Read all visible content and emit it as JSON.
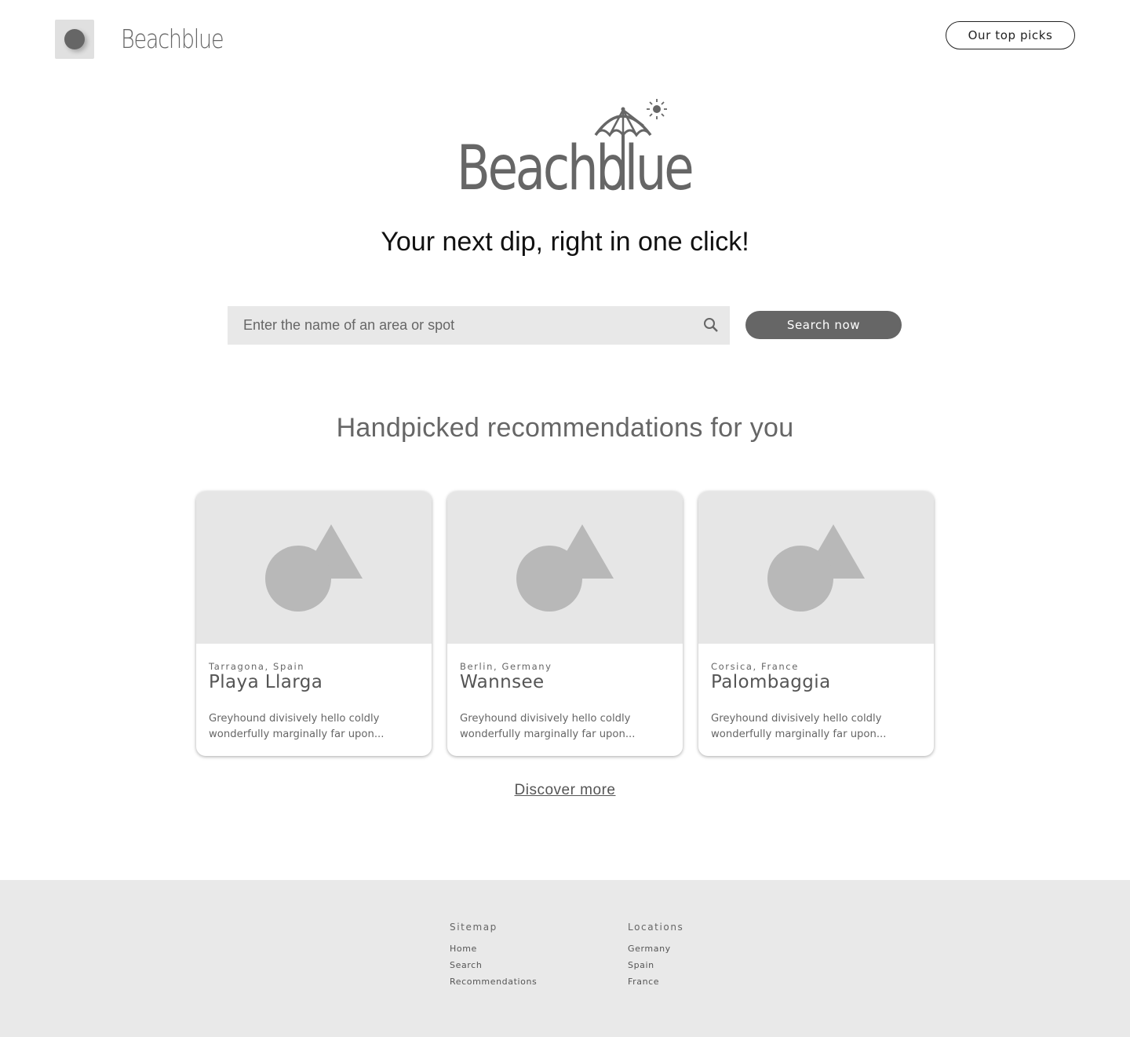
{
  "header": {
    "brand": "Beachblue",
    "top_picks_label": "Our top picks"
  },
  "hero": {
    "logo_text": "Beachblue",
    "tagline": "Your next dip, right in one click!"
  },
  "search": {
    "placeholder": "Enter the name of an area or spot",
    "value": "",
    "button_label": "Search now"
  },
  "recommendations": {
    "title": "Handpicked recommendations for you",
    "cards": [
      {
        "location": "Tarragona, Spain",
        "name": "Playa Llarga",
        "description": "Greyhound divisively hello coldly wonderfully marginally far upon..."
      },
      {
        "location": "Berlin, Germany",
        "name": "Wannsee",
        "description": "Greyhound divisively hello coldly wonderfully marginally far upon..."
      },
      {
        "location": "Corsica, France",
        "name": "Palombaggia",
        "description": "Greyhound divisively hello coldly wonderfully marginally far upon..."
      }
    ],
    "discover_label": "Discover more"
  },
  "footer": {
    "sitemap": {
      "heading": "Sitemap",
      "links": [
        "Home",
        "Search",
        "Recommendations"
      ]
    },
    "locations": {
      "heading": "Locations",
      "links": [
        "Germany",
        "Spain",
        "France"
      ]
    }
  },
  "colors": {
    "button_dark": "#666666",
    "placeholder_bg": "#e6e6e6",
    "footer_bg": "#e9e9e9"
  }
}
